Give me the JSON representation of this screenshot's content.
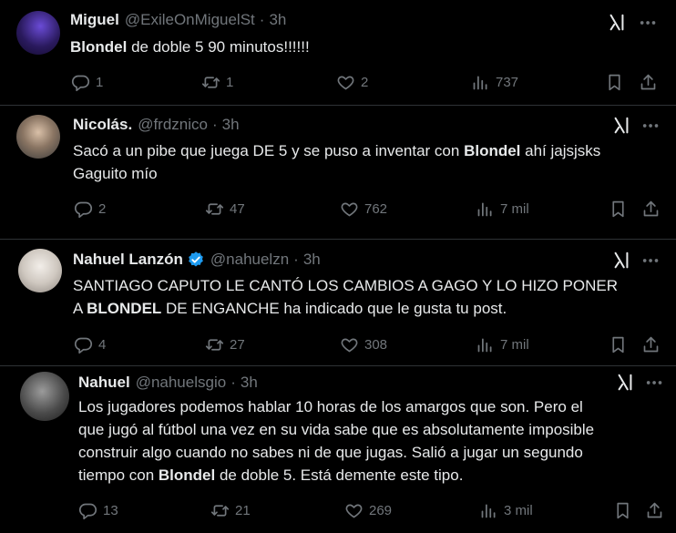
{
  "tweets": [
    {
      "name": "Miguel",
      "handle": "@ExileOnMiguelSt",
      "time": "3h",
      "text_parts": [
        "",
        "Blondel",
        " de doble 5 90 minutos!!!!!!"
      ],
      "replies": "1",
      "reposts": "1",
      "likes": "2",
      "views": "737"
    },
    {
      "name": "Nicolás.",
      "handle": "@frdznico",
      "time": "3h",
      "line1": [
        "Sacó a un pibe que juega DE 5 y se puso a inventar con ",
        "Blondel",
        " ahí jajsjsks"
      ],
      "line2": "Gaguito mío",
      "replies": "2",
      "reposts": "47",
      "likes": "762",
      "views": "7 mil"
    },
    {
      "name": "Nahuel Lanzón",
      "handle": "@nahuelzn",
      "time": "3h",
      "verified": true,
      "line1": "SANTIAGO CAPUTO LE CANTÓ LOS CAMBIOS A GAGO Y LO HIZO PONER",
      "line2": [
        "A ",
        "BLONDEL",
        " DE ENGANCHE ha indicado que le gusta tu post."
      ],
      "replies": "4",
      "reposts": "27",
      "likes": "308",
      "views": "7 mil"
    },
    {
      "name": "Nahuel",
      "handle": "@nahuelsgio",
      "time": "3h",
      "line1": "Los jugadores podemos hablar 10 horas de los amargos que son. Pero el",
      "line2": "que jugó al fútbol una vez en su vida sabe que es absolutamente imposible",
      "line3": "construir algo cuando no sabes ni de que jugas. Salió a jugar un segundo",
      "line4": [
        "tiempo con ",
        "Blondel",
        " de doble 5. Está demente este tipo."
      ],
      "replies": "13",
      "reposts": "21",
      "likes": "269",
      "views": "3 mil"
    }
  ],
  "separator": "·",
  "colors": {
    "text": "#e7e9ea",
    "muted": "#71767b",
    "verified": "#1d9bf0",
    "divider": "#2f3336"
  }
}
